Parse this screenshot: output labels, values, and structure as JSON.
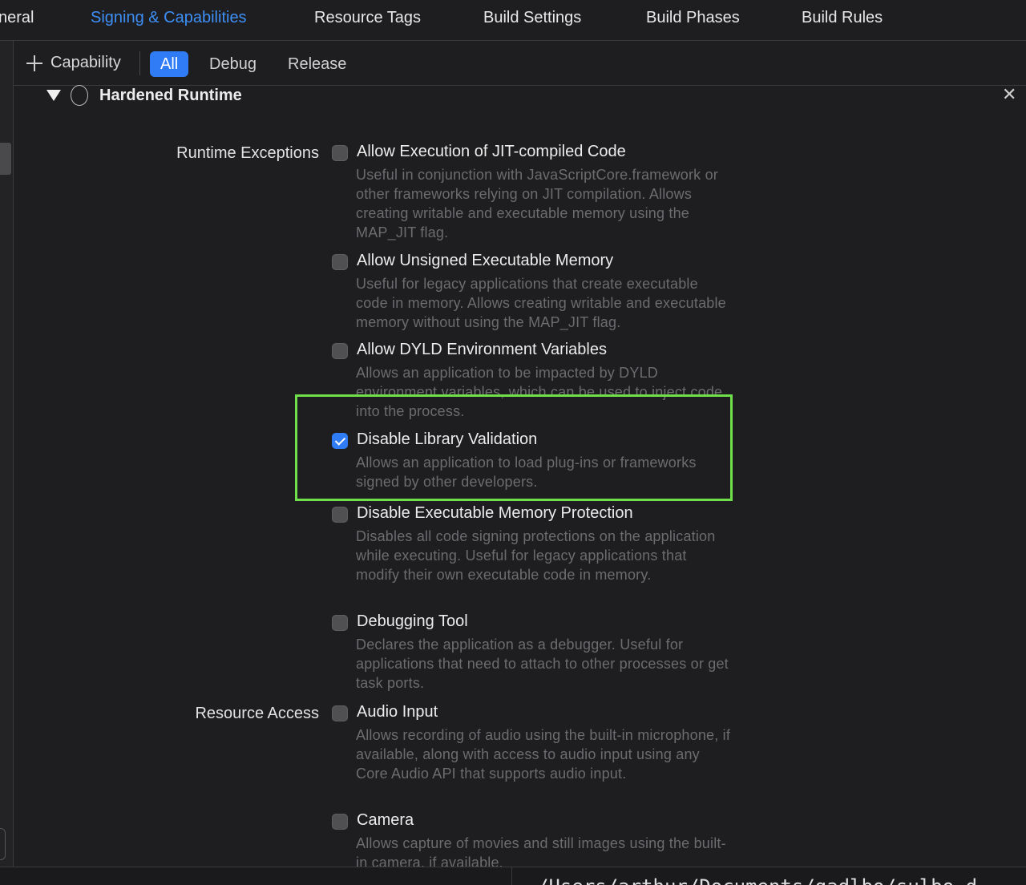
{
  "tabs": [
    {
      "label": "neral",
      "active": false
    },
    {
      "label": "Signing & Capabilities",
      "active": true
    },
    {
      "label": "Resource Tags",
      "active": false
    },
    {
      "label": "Build Settings",
      "active": false
    },
    {
      "label": "Build Phases",
      "active": false
    },
    {
      "label": "Build Rules",
      "active": false
    }
  ],
  "filter": {
    "add_label": "Capability",
    "segments": [
      "All",
      "Debug",
      "Release"
    ],
    "selected": "All"
  },
  "section": {
    "title": "Hardened Runtime",
    "close_glyph": "✕"
  },
  "groups": {
    "runtime_exceptions": "Runtime Exceptions",
    "resource_access": "Resource Access"
  },
  "options": [
    {
      "title": "Allow Execution of JIT-compiled Code",
      "checked": false,
      "desc": "Useful in conjunction with JavaScriptCore.framework or other frameworks relying on JIT compilation. Allows creating writable and executable memory using the MAP_JIT flag."
    },
    {
      "title": "Allow Unsigned Executable Memory",
      "checked": false,
      "desc": "Useful for legacy applications that create executable code in memory. Allows creating writable and executable memory without using the MAP_JIT flag."
    },
    {
      "title": "Allow DYLD Environment Variables",
      "checked": false,
      "desc": "Allows an application to be impacted by DYLD environment variables, which can be used to inject code into the process."
    },
    {
      "title": "Disable Library Validation",
      "checked": true,
      "desc": "Allows an application to load plug-ins or frameworks signed by other developers."
    },
    {
      "title": "Disable Executable Memory Protection",
      "checked": false,
      "desc": "Disables all code signing protections on the application while executing. Useful for legacy applications that modify their own executable code in memory."
    },
    {
      "title": "Debugging Tool",
      "checked": false,
      "desc": "Declares the application as a debugger. Useful for applications that need to attach to other processes or get task ports."
    },
    {
      "title": "Audio Input",
      "checked": false,
      "desc": "Allows recording of audio using the built-in microphone, if available, along with access to audio input using any Core Audio API that supports audio input."
    },
    {
      "title": "Camera",
      "checked": false,
      "desc": "Allows capture of movies and still images using the built-in camera, if available."
    }
  ],
  "status_path": "/Users/arthur/Documents/gadlbo/sulbo_d",
  "colors": {
    "accent": "#2f7cf6",
    "tab_active": "#3d8ff7",
    "highlight_box": "#6fe04a",
    "background": "#1e1e20"
  },
  "icons": [
    "plus-icon",
    "disclosure-triangle-icon",
    "capability-circle-icon",
    "close-icon",
    "checkmark-icon"
  ]
}
